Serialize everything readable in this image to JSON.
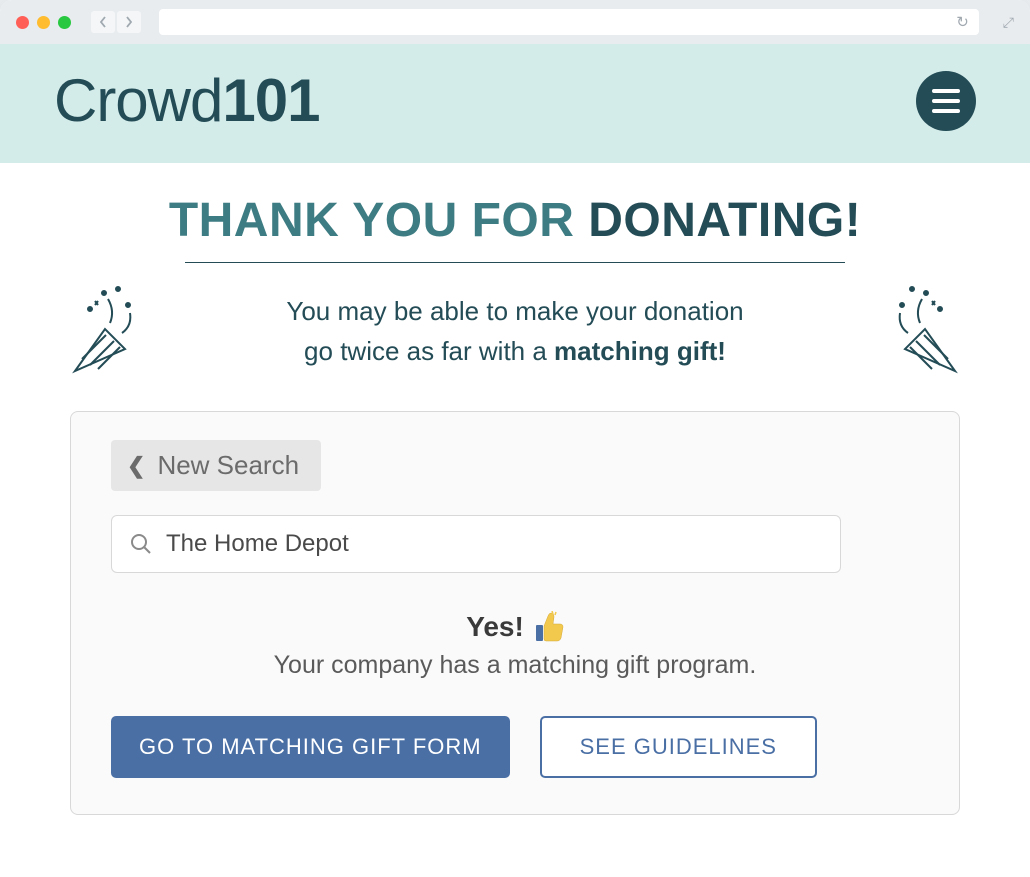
{
  "header": {
    "logo_crowd": "Crowd",
    "logo_101": "101"
  },
  "main": {
    "title_prefix": "THANK YOU FOR ",
    "title_bold": "DONATING!",
    "subtitle_line1": "You may be able to make your donation",
    "subtitle_line2_prefix": "go twice as far with a ",
    "subtitle_line2_bold": "matching gift!"
  },
  "search_panel": {
    "new_search_label": "New Search",
    "search_value": "The Home Depot",
    "result_yes": "Yes!",
    "result_desc": "Your company has a matching gift program.",
    "btn_primary": "GO TO MATCHING GIFT FORM",
    "btn_secondary": "SEE GUIDELINES"
  }
}
